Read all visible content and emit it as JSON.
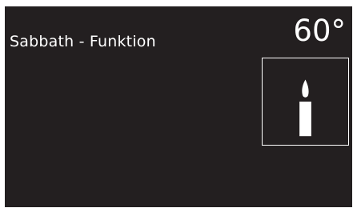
{
  "display": {
    "function_label": "Sabbath - Funktion",
    "temperature": "60°",
    "mode_icon": "candle-icon",
    "colors": {
      "background": "#231f20",
      "foreground": "#ffffff"
    }
  }
}
